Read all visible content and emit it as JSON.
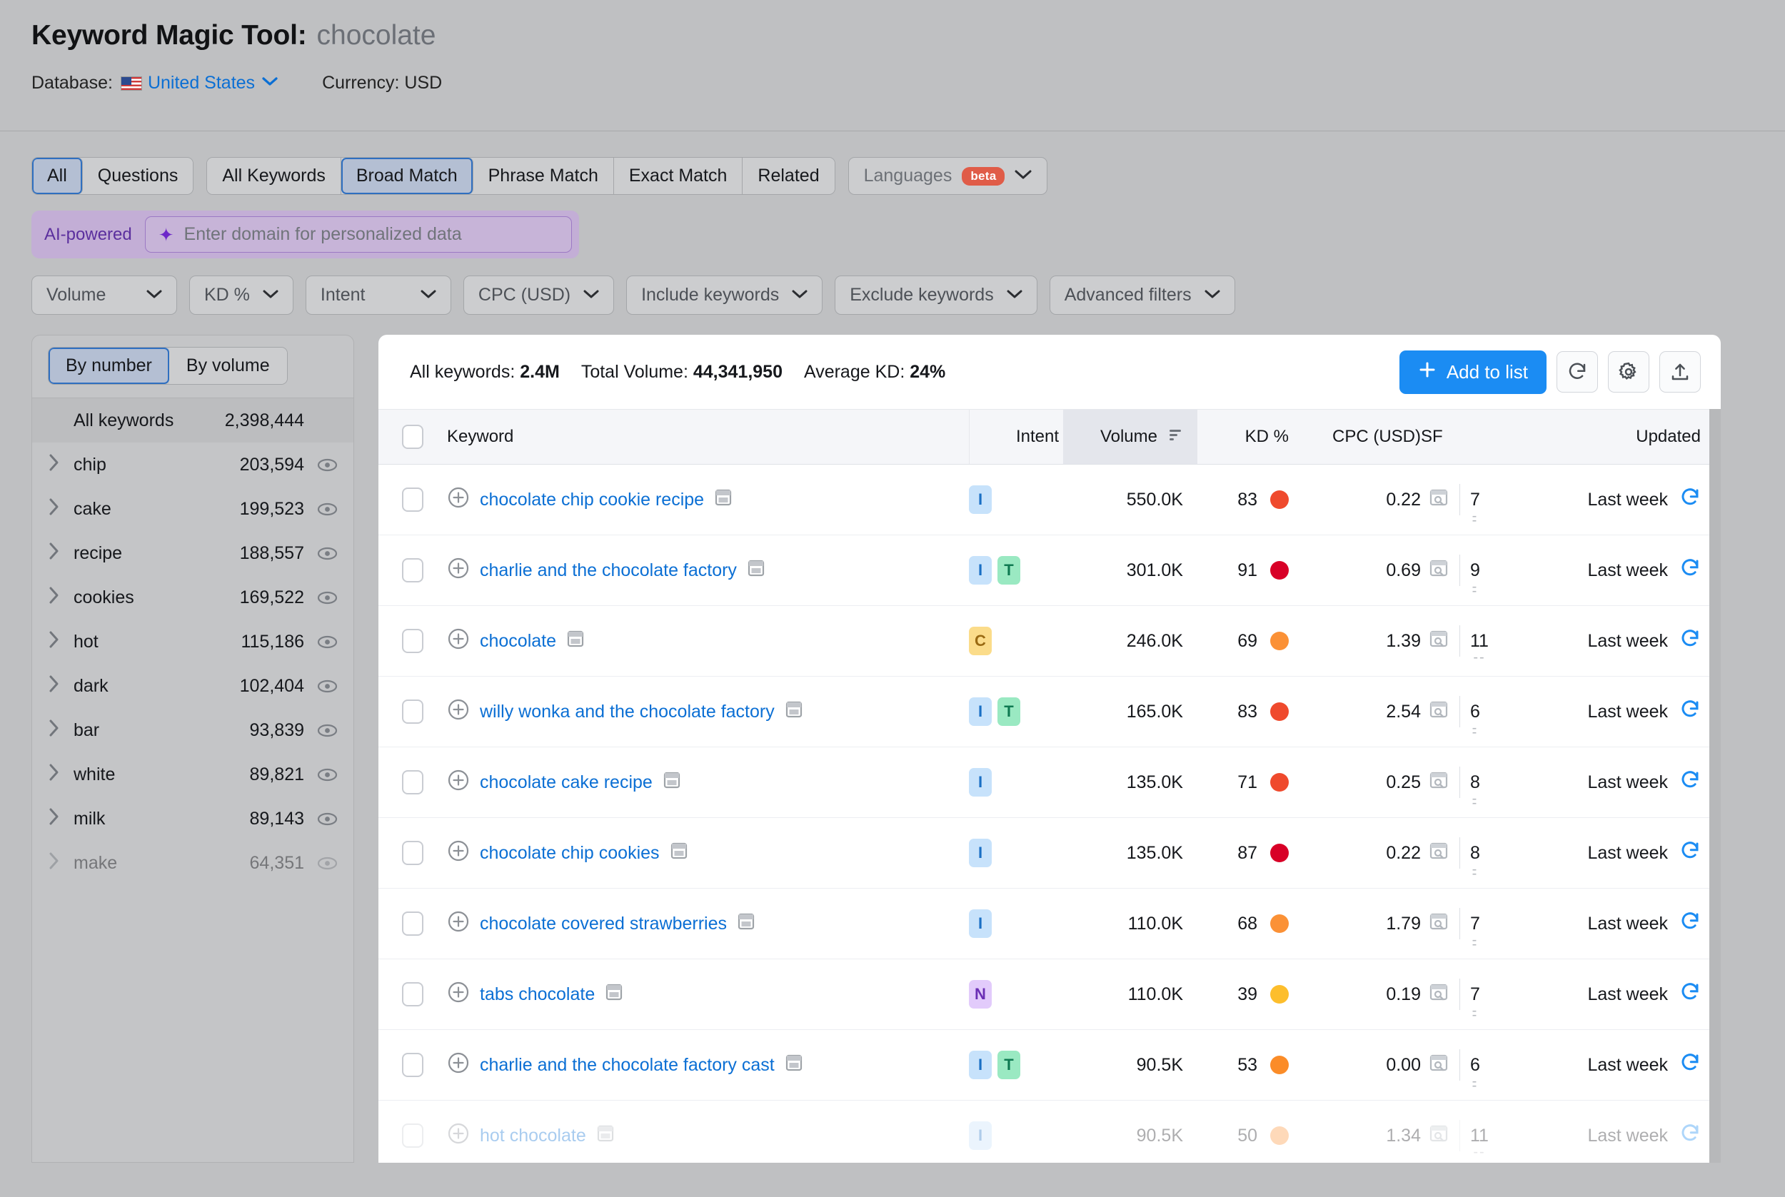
{
  "header": {
    "title_main": "Keyword Magic Tool:",
    "title_query": "chocolate",
    "database_label": "Database:",
    "database_value": "United States",
    "currency": "Currency: USD",
    "flag_icon": "us-flag-icon"
  },
  "tabs": {
    "group1": [
      {
        "label": "All",
        "active": true
      },
      {
        "label": "Questions",
        "active": false
      }
    ],
    "group2": [
      {
        "label": "All Keywords",
        "active": false
      },
      {
        "label": "Broad Match",
        "active": true
      },
      {
        "label": "Phrase Match",
        "active": false
      },
      {
        "label": "Exact Match",
        "active": false
      },
      {
        "label": "Related",
        "active": false
      }
    ],
    "languages": {
      "label": "Languages",
      "badge": "beta"
    }
  },
  "ai_bar": {
    "label": "AI-powered",
    "placeholder": "Enter domain for personalized data",
    "value": ""
  },
  "filters": [
    {
      "label": "Volume"
    },
    {
      "label": "KD %"
    },
    {
      "label": "Intent"
    },
    {
      "label": "CPC (USD)"
    },
    {
      "label": "Include keywords"
    },
    {
      "label": "Exclude keywords"
    },
    {
      "label": "Advanced filters"
    }
  ],
  "sidebar": {
    "toggle": [
      {
        "label": "By number",
        "active": true
      },
      {
        "label": "By volume",
        "active": false
      }
    ],
    "all_keywords": {
      "label": "All keywords",
      "count": "2,398,444"
    },
    "groups": [
      {
        "label": "chip",
        "count": "203,594"
      },
      {
        "label": "cake",
        "count": "199,523"
      },
      {
        "label": "recipe",
        "count": "188,557"
      },
      {
        "label": "cookies",
        "count": "169,522"
      },
      {
        "label": "hot",
        "count": "115,186"
      },
      {
        "label": "dark",
        "count": "102,404"
      },
      {
        "label": "bar",
        "count": "93,839"
      },
      {
        "label": "white",
        "count": "89,821"
      },
      {
        "label": "milk",
        "count": "89,143"
      },
      {
        "label": "make",
        "count": "64,351"
      }
    ]
  },
  "table": {
    "stats": {
      "all_keywords_label": "All keywords:",
      "all_keywords_value": "2.4M",
      "total_volume_label": "Total Volume:",
      "total_volume_value": "44,341,950",
      "average_kd_label": "Average KD:",
      "average_kd_value": "24%"
    },
    "actions": {
      "add_to_list": "Add to list",
      "refresh_icon": "refresh-icon",
      "settings_icon": "gear-icon",
      "export_icon": "export-icon"
    },
    "columns": {
      "keyword": "Keyword",
      "intent": "Intent",
      "volume": "Volume",
      "kd": "KD %",
      "cpc": "CPC (USD)",
      "sf": "SF",
      "updated": "Updated"
    },
    "sorted_column": "Volume",
    "rows": [
      {
        "keyword": "chocolate chip cookie recipe",
        "intent": [
          "I"
        ],
        "volume": "550.0K",
        "kd": "83",
        "kd_color": "#ef4a2d",
        "cpc": "0.22",
        "sf": "7",
        "updated": "Last week"
      },
      {
        "keyword": "charlie and the chocolate factory",
        "intent": [
          "I",
          "T"
        ],
        "volume": "301.0K",
        "kd": "91",
        "kd_color": "#d80027",
        "cpc": "0.69",
        "sf": "9",
        "updated": "Last week"
      },
      {
        "keyword": "chocolate",
        "intent": [
          "C"
        ],
        "volume": "246.0K",
        "kd": "69",
        "kd_color": "#fb9136",
        "cpc": "1.39",
        "sf": "11",
        "updated": "Last week"
      },
      {
        "keyword": "willy wonka and the chocolate factory",
        "intent": [
          "I",
          "T"
        ],
        "volume": "165.0K",
        "kd": "83",
        "kd_color": "#ef4a2d",
        "cpc": "2.54",
        "sf": "6",
        "updated": "Last week"
      },
      {
        "keyword": "chocolate cake recipe",
        "intent": [
          "I"
        ],
        "volume": "135.0K",
        "kd": "71",
        "kd_color": "#ef4a2d",
        "cpc": "0.25",
        "sf": "8",
        "updated": "Last week"
      },
      {
        "keyword": "chocolate chip cookies",
        "intent": [
          "I"
        ],
        "volume": "135.0K",
        "kd": "87",
        "kd_color": "#d80027",
        "cpc": "0.22",
        "sf": "8",
        "updated": "Last week"
      },
      {
        "keyword": "chocolate covered strawberries",
        "intent": [
          "I"
        ],
        "volume": "110.0K",
        "kd": "68",
        "kd_color": "#fb9136",
        "cpc": "1.79",
        "sf": "7",
        "updated": "Last week"
      },
      {
        "keyword": "tabs chocolate",
        "intent": [
          "N"
        ],
        "volume": "110.0K",
        "kd": "39",
        "kd_color": "#fdbe2c",
        "cpc": "0.19",
        "sf": "7",
        "updated": "Last week"
      },
      {
        "keyword": "charlie and the chocolate factory cast",
        "intent": [
          "I",
          "T"
        ],
        "volume": "90.5K",
        "kd": "53",
        "kd_color": "#fb8c28",
        "cpc": "0.00",
        "sf": "6",
        "updated": "Last week"
      },
      {
        "keyword": "hot chocolate",
        "intent": [
          "I"
        ],
        "volume": "90.5K",
        "kd": "50",
        "kd_color": "#fb9136",
        "cpc": "1.34",
        "sf": "11",
        "updated": "Last week"
      }
    ]
  },
  "colors": {
    "accent_blue": "#1b8cf3",
    "link_blue": "#0b6fd4",
    "page_bg": "#bfc0c2",
    "beta_red": "#e05c48",
    "ai_purple": "#5b2f9e"
  }
}
